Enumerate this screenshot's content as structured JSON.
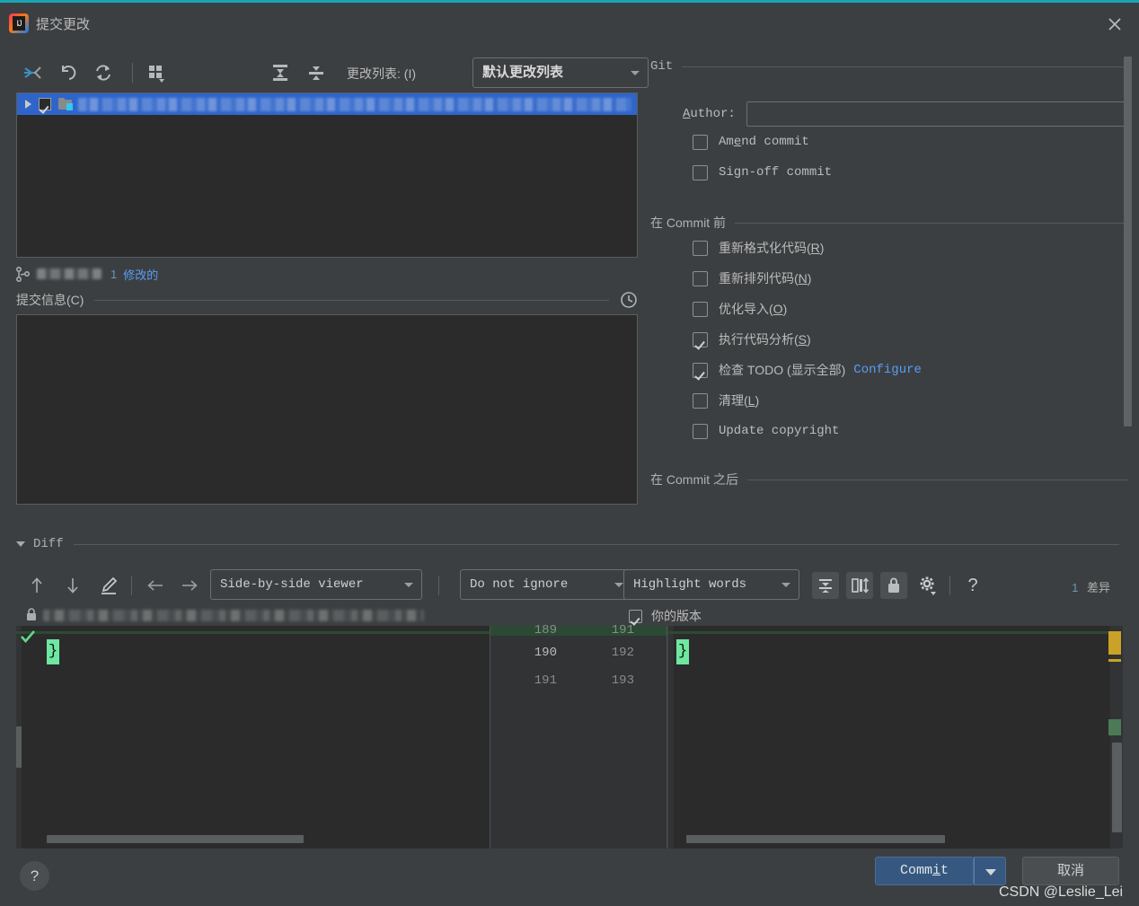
{
  "window": {
    "title": "提交更改",
    "logo_icon": "intellij-idea-logo",
    "close_icon": "close-icon",
    "accent_top_border": "#1aa5b5"
  },
  "toolbar": {
    "icons": [
      {
        "name": "show-diff-icon",
        "label": ""
      },
      {
        "name": "rollback-icon",
        "label": ""
      },
      {
        "name": "refresh-icon",
        "label": ""
      },
      {
        "name": "group-by-icon",
        "label": ""
      },
      {
        "name": "expand-all-icon",
        "label": ""
      },
      {
        "name": "collapse-all-icon",
        "label": ""
      }
    ],
    "changelist_label": "更改列表:",
    "changelist_mnemonic": "(I)",
    "changelist_value": "默认更改列表"
  },
  "file_list": {
    "rows": [
      {
        "checked": true,
        "expanded": false,
        "name_blurred": true,
        "icon": "folder-icon"
      }
    ]
  },
  "branch_bar": {
    "branch_icon": "git-branch-icon",
    "branch_name_blurred": true,
    "count": "1",
    "status_label": "修改的"
  },
  "commit_message": {
    "section_label": "提交信息",
    "section_mnemonic": "(C)",
    "history_icon": "history-clock-icon",
    "value": "",
    "placeholder": ""
  },
  "git_panel": {
    "group_git": "Git",
    "author_label": "Author:",
    "author_mnemonic_letter": "A",
    "author_value": "",
    "author_placeholder": "",
    "amend_commit": {
      "label": "Amend commit",
      "checked": false
    },
    "signoff_commit": {
      "label": "Sign-off commit",
      "checked": false
    },
    "group_before_commit": "在 Commit 前",
    "before_commit_items": [
      {
        "label": "重新格式化代码",
        "mnemonic": "(R)",
        "checked": false
      },
      {
        "label": "重新排列代码",
        "mnemonic": "(N)",
        "checked": false
      },
      {
        "label": "优化导入",
        "mnemonic": "(O)",
        "checked": false
      },
      {
        "label": "执行代码分析",
        "mnemonic": "(S)",
        "checked": true
      },
      {
        "label": "检查 TODO (显示全部)",
        "mnemonic": "",
        "checked": true,
        "link": "Configure"
      },
      {
        "label": "清理",
        "mnemonic": "(L)",
        "checked": false
      },
      {
        "label": "Update copyright",
        "mnemonic": "",
        "checked": false
      }
    ],
    "group_after_commit": "在 Commit 之后",
    "link_color": "#589df6"
  },
  "diff": {
    "section_label": "Diff",
    "collapse_caret": "chevron-down-icon",
    "toolbar_icons": [
      {
        "name": "previous-difference-icon"
      },
      {
        "name": "next-difference-icon"
      },
      {
        "name": "annotate-icon"
      },
      {
        "name": "accept-left-icon"
      },
      {
        "name": "accept-right-icon"
      },
      {
        "name": "collapse-unchanged-icon"
      },
      {
        "name": "synchronize-scrolling-icon"
      },
      {
        "name": "read-only-lock-icon"
      },
      {
        "name": "settings-gear-icon"
      },
      {
        "name": "help-question-icon"
      }
    ],
    "viewer_mode": "Side-by-side viewer",
    "whitespace_mode": "Do not ignore",
    "highlight_mode": "Highlight words",
    "difference_count": "1",
    "difference_label": "差异",
    "file_path_blurred": true,
    "lock_icon": "lock-icon",
    "your_version_label": "你的版本",
    "your_version_checked": true,
    "left_pane": {
      "accept_icon": "accept-change-checkmark-icon",
      "code_line": "}"
    },
    "right_pane": {
      "code_line": "}"
    },
    "line_numbers": [
      {
        "old": "189",
        "new": "191",
        "partial": true
      },
      {
        "old": "190",
        "new": "192",
        "partial": false
      },
      {
        "old": "191",
        "new": "193",
        "partial": false
      }
    ],
    "added_highlight_color": "#6ee7a0",
    "change_band_color": "#2c4a33",
    "marker_warning_color": "#c9a227",
    "marker_change_color": "#4c7a57"
  },
  "footer": {
    "help_icon": "help-question-icon",
    "help_label": "?",
    "commit_label": "Commit",
    "commit_mnemonic_letter": "t",
    "commit_dropdown_icon": "chevron-down-icon",
    "cancel_label": "取消"
  },
  "watermark": {
    "text": "CSDN @Leslie_Lei"
  }
}
